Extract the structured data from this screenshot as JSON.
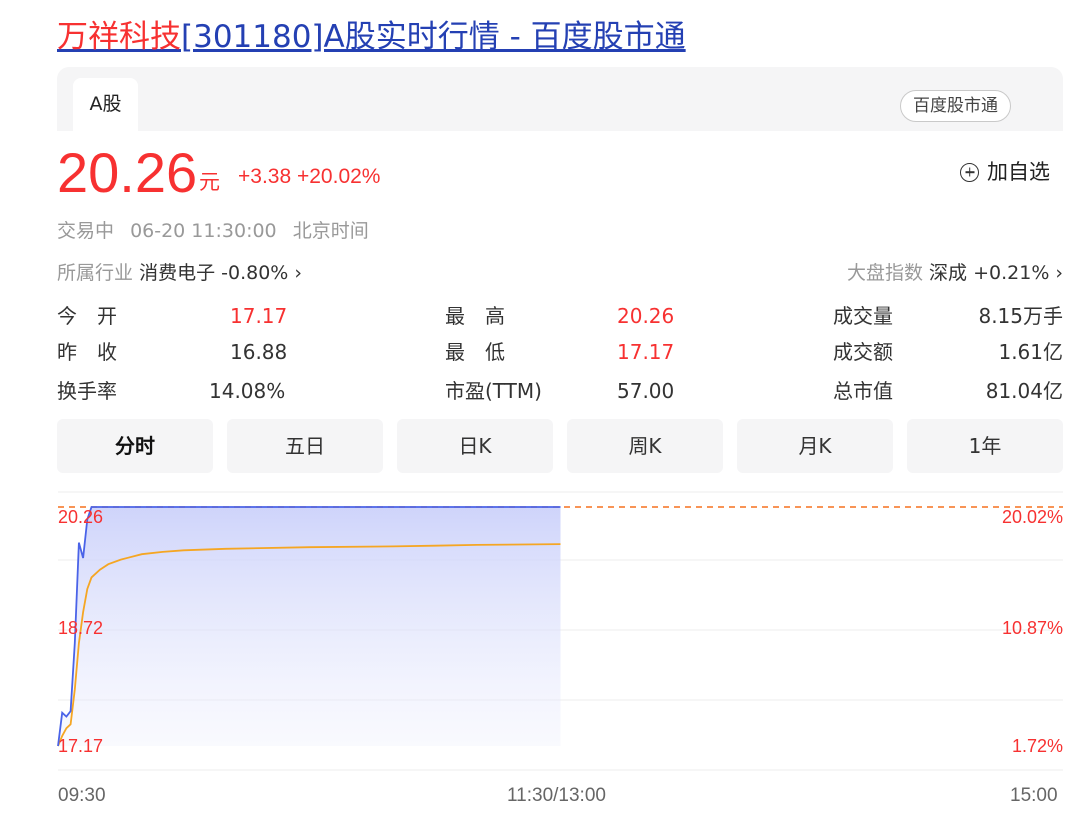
{
  "page_title": {
    "name": "万祥科技",
    "rest": "[301180]A股实时行情 - 百度股市通"
  },
  "tabs": {
    "active": "A股",
    "source_badge": "百度股市通"
  },
  "quote": {
    "price": "20.26",
    "unit": "元",
    "change": "+3.38",
    "change_pct": "+20.02%",
    "watch_label": "加自选",
    "status": "交易中",
    "date_time": "06-20 11:30:00",
    "timezone": "北京时间"
  },
  "industry": {
    "label": "所属行业",
    "name": "消费电子",
    "change": "-0.80%"
  },
  "market_index": {
    "label": "大盘指数",
    "name": "深成",
    "change": "+0.21%"
  },
  "stats": {
    "open": {
      "label": "今　开",
      "value": "17.17"
    },
    "prev_close": {
      "label": "昨　收",
      "value": "16.88"
    },
    "turnover_rate": {
      "label": "换手率",
      "value": "14.08%"
    },
    "high": {
      "label": "最　高",
      "value": "20.26"
    },
    "low": {
      "label": "最　低",
      "value": "17.17"
    },
    "pe_ttm": {
      "label": "市盈(TTM)",
      "value": "57.00"
    },
    "volume": {
      "label": "成交量",
      "value": "8.15万手"
    },
    "amount": {
      "label": "成交额",
      "value": "1.61亿"
    },
    "market_cap": {
      "label": "总市值",
      "value": "81.04亿"
    }
  },
  "period_tabs": [
    "分时",
    "五日",
    "日K",
    "周K",
    "月K",
    "1年"
  ],
  "colors": {
    "up": "#f73131",
    "link": "#2440b3",
    "price_line": "#4a63e8",
    "avg_line": "#f5a623"
  },
  "chart_data": {
    "type": "line",
    "title": "",
    "price_axis": {
      "min": 17.17,
      "mid": 18.72,
      "max": 20.26,
      "labels": [
        "20.26",
        "18.72",
        "17.17"
      ]
    },
    "pct_axis": {
      "labels": [
        "20.02%",
        "10.87%",
        "1.72%"
      ]
    },
    "time_labels": [
      "09:30",
      "11:30/13:00",
      "15:00"
    ],
    "x_minutes_domain": [
      0,
      240
    ],
    "reference_line": 20.26,
    "series": [
      {
        "key": "price",
        "x": [
          0,
          1,
          2,
          3,
          4,
          5,
          6,
          7,
          8,
          9,
          10,
          12,
          15,
          20,
          30,
          60,
          90,
          120
        ],
        "values": [
          17.17,
          17.6,
          17.55,
          17.62,
          18.5,
          19.8,
          19.6,
          20.1,
          20.26,
          20.26,
          20.26,
          20.26,
          20.26,
          20.26,
          20.26,
          20.26,
          20.26,
          20.26
        ]
      },
      {
        "key": "average",
        "x": [
          0,
          1,
          2,
          3,
          4,
          5,
          6,
          7,
          8,
          10,
          12,
          15,
          20,
          25,
          30,
          40,
          60,
          80,
          90,
          100,
          120
        ],
        "values": [
          17.17,
          17.3,
          17.4,
          17.45,
          17.9,
          18.5,
          18.9,
          19.2,
          19.35,
          19.45,
          19.52,
          19.58,
          19.65,
          19.68,
          19.7,
          19.72,
          19.74,
          19.75,
          19.76,
          19.77,
          19.78
        ]
      }
    ]
  }
}
